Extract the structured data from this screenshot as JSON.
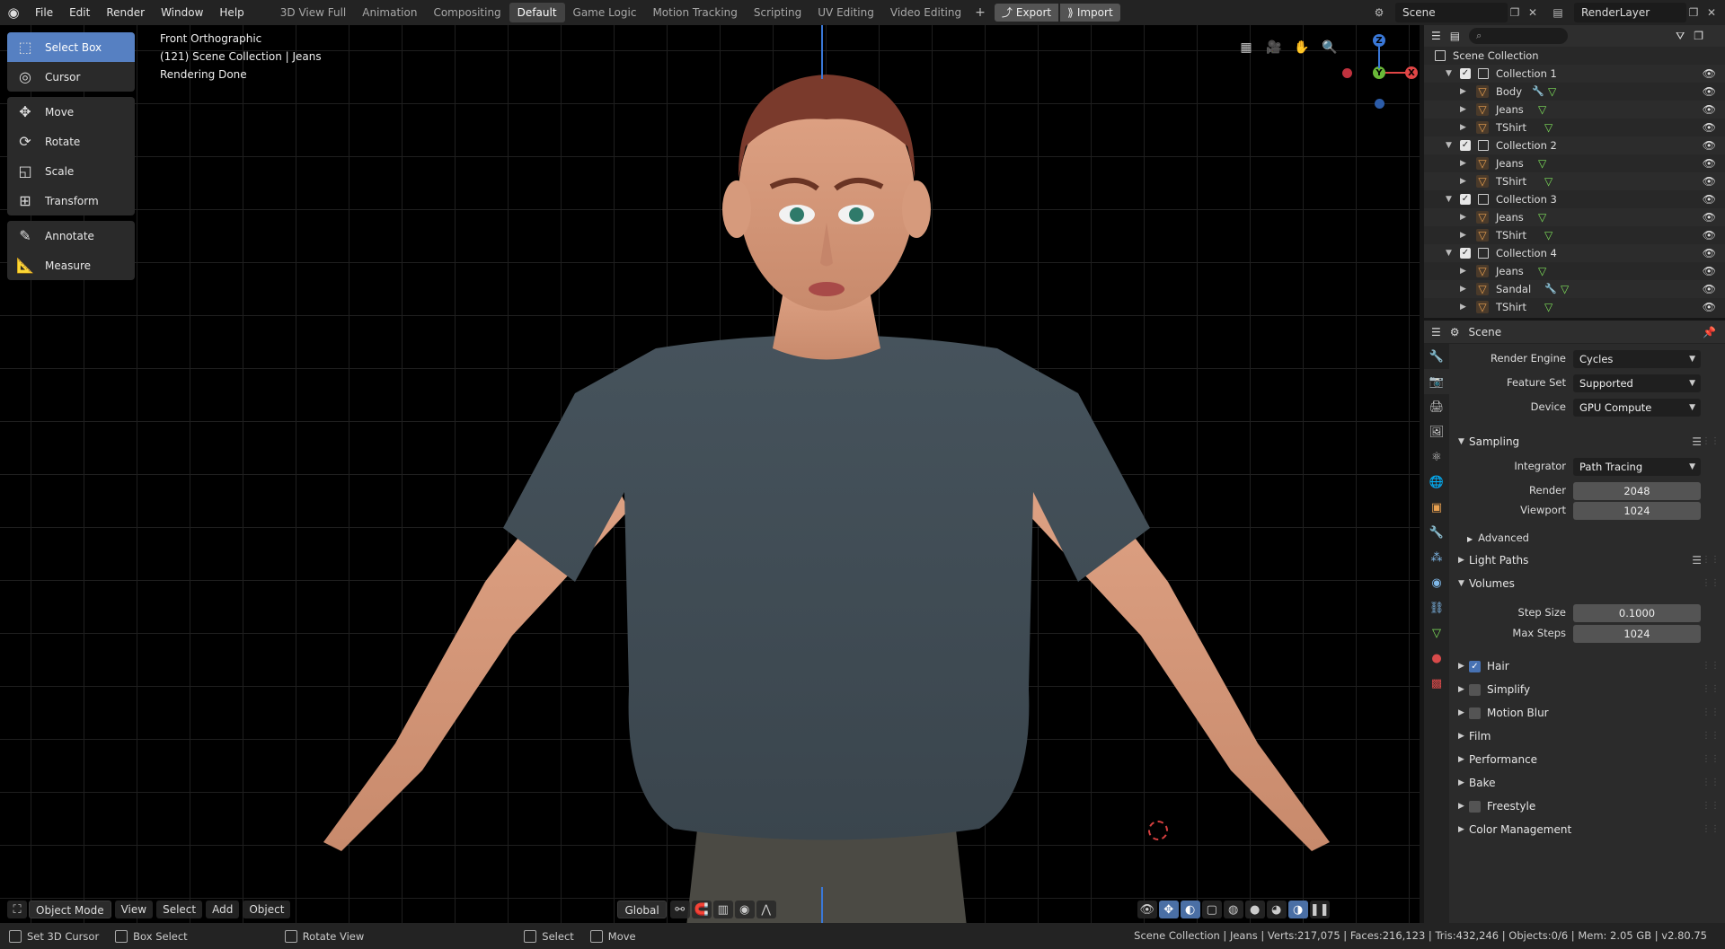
{
  "topbar": {
    "menus": [
      "File",
      "Edit",
      "Render",
      "Window",
      "Help"
    ],
    "workspaces": [
      "3D View Full",
      "Animation",
      "Compositing",
      "Default",
      "Game Logic",
      "Motion Tracking",
      "Scripting",
      "UV Editing",
      "Video Editing"
    ],
    "active_workspace": "Default",
    "export_label": "Export",
    "import_label": "Import",
    "scene_name": "Scene",
    "render_layer": "RenderLayer"
  },
  "toolbar": {
    "tools": [
      "Select Box",
      "Cursor",
      "Move",
      "Rotate",
      "Scale",
      "Transform",
      "Annotate",
      "Measure"
    ],
    "active_tool": "Select Box"
  },
  "viewport": {
    "view_name": "Front Orthographic",
    "collection_info": "(121) Scene Collection | Jeans",
    "render_status": "Rendering Done",
    "gizmo": {
      "z": "Z",
      "y": "Y",
      "x": "X"
    },
    "header": {
      "mode": "Object Mode",
      "menus": [
        "View",
        "Select",
        "Add",
        "Object"
      ],
      "orientation": "Global"
    }
  },
  "outliner": {
    "root": "Scene Collection",
    "collections": [
      {
        "name": "Collection 1",
        "objects": [
          "Body",
          "Jeans",
          "TShirt"
        ]
      },
      {
        "name": "Collection 2",
        "objects": [
          "Jeans",
          "TShirt"
        ]
      },
      {
        "name": "Collection 3",
        "objects": [
          "Jeans",
          "TShirt"
        ]
      },
      {
        "name": "Collection 4",
        "objects": [
          "Jeans",
          "Sandal",
          "TShirt"
        ]
      }
    ]
  },
  "properties": {
    "context": "Scene",
    "render_engine_label": "Render Engine",
    "render_engine": "Cycles",
    "feature_set_label": "Feature Set",
    "feature_set": "Supported",
    "device_label": "Device",
    "device": "GPU Compute",
    "sampling": {
      "title": "Sampling",
      "integrator_label": "Integrator",
      "integrator": "Path Tracing",
      "render_label": "Render",
      "render": "2048",
      "viewport_label": "Viewport",
      "viewport": "1024",
      "advanced": "Advanced"
    },
    "light_paths": "Light Paths",
    "volumes": {
      "title": "Volumes",
      "step_size_label": "Step Size",
      "step_size": "0.1000",
      "max_steps_label": "Max Steps",
      "max_steps": "1024"
    },
    "panels": [
      "Hair",
      "Simplify",
      "Motion Blur",
      "Film",
      "Performance",
      "Bake",
      "Freestyle",
      "Color Management"
    ],
    "hair_enabled": true
  },
  "statusbar": {
    "set_cursor": "Set 3D Cursor",
    "box_select": "Box Select",
    "rotate_view": "Rotate View",
    "select": "Select",
    "move": "Move",
    "stats": "Scene Collection | Jeans | Verts:217,075 | Faces:216,123 | Tris:432,246 | Objects:0/6 | Mem: 2.05 GB | v2.80.75"
  },
  "colors": {
    "accent": "#5680c2",
    "axis_x": "#e04646",
    "axis_y": "#6ab838",
    "axis_z": "#3a78d8"
  }
}
